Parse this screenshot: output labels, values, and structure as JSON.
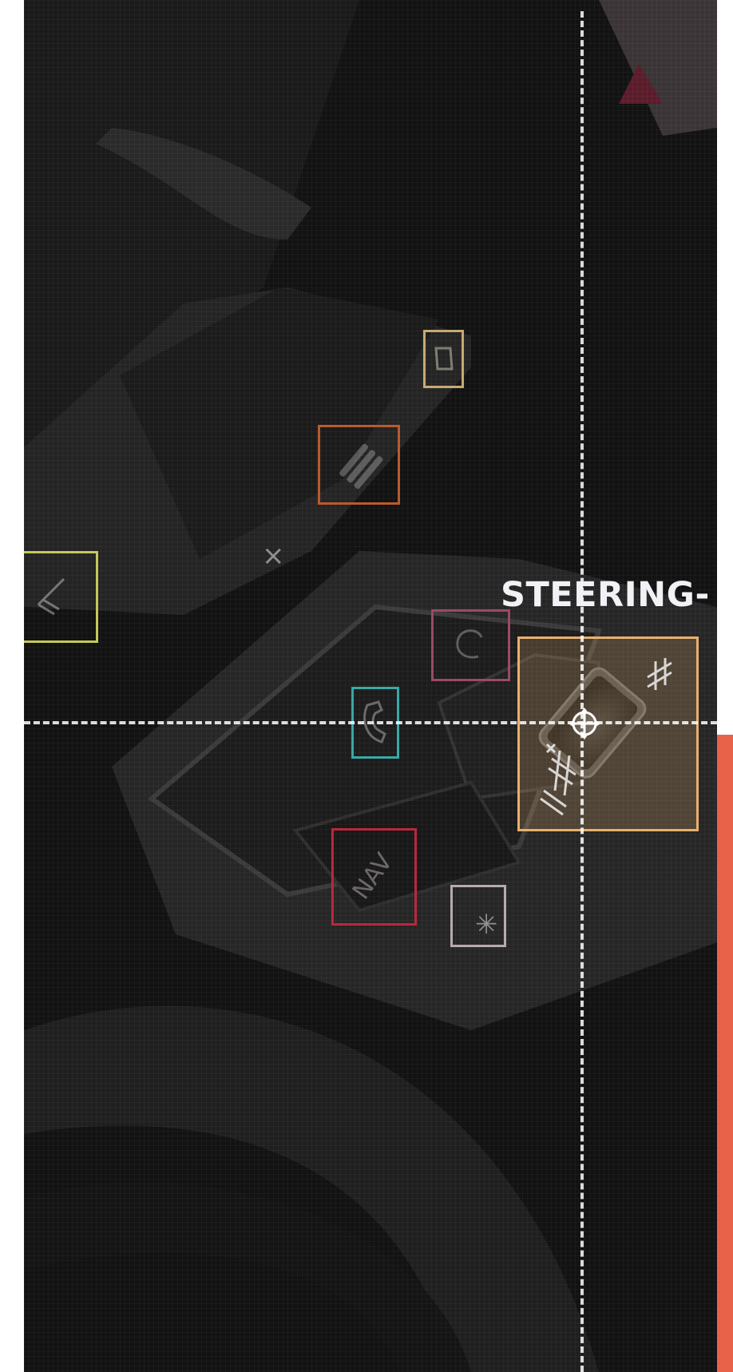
{
  "overlay": {
    "label": "STEERING-",
    "hotspot_color": "#e8b070",
    "accent_color": "#e8624a"
  },
  "controls": [
    {
      "name": "wiper-button",
      "color": "#c5c85a"
    },
    {
      "name": "lights-button",
      "color": "#b95a2e"
    },
    {
      "name": "phone-top-button",
      "color": "#c8aa70"
    },
    {
      "name": "voice-button",
      "color": "#9a4a66"
    },
    {
      "name": "call-button",
      "color": "#3aa8a8"
    },
    {
      "name": "nav-button",
      "color": "#b8283c"
    },
    {
      "name": "settings-button",
      "color": "#b9a9b0"
    }
  ],
  "icons": {
    "nav": "NAV",
    "close_glyph": "×",
    "star_glyph": "✳",
    "move_icon": "move-icon"
  }
}
